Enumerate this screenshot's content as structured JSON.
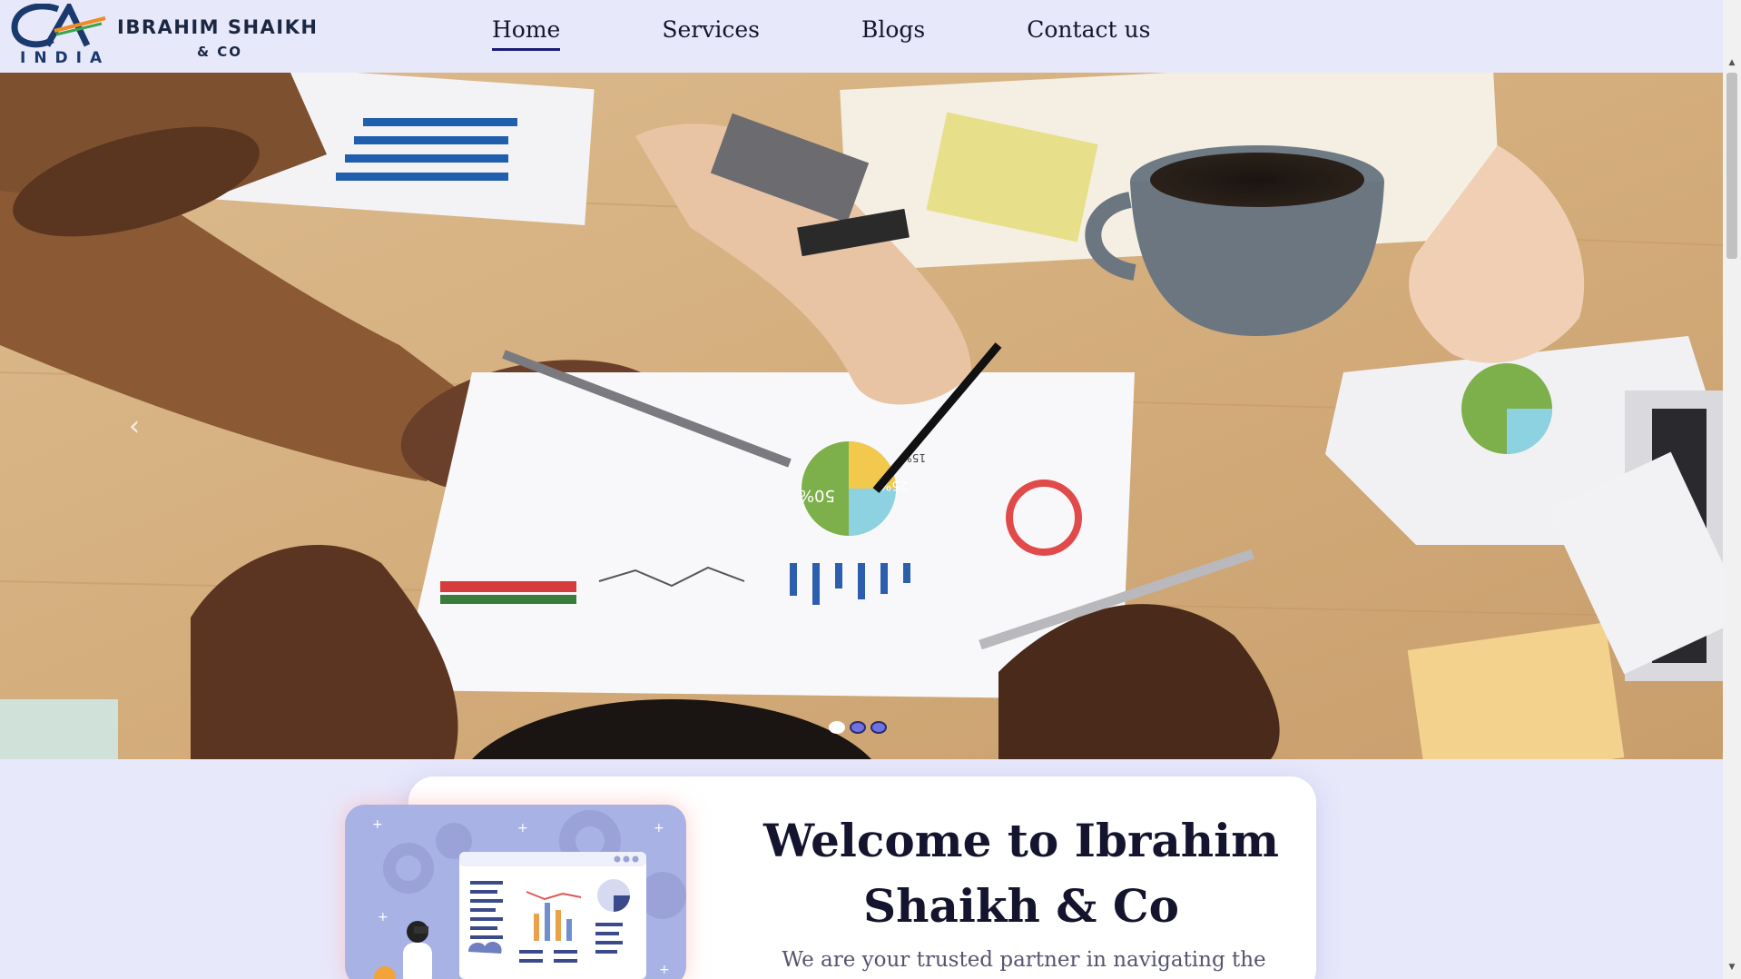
{
  "header": {
    "logo": {
      "mark": "CA",
      "country": "INDIA",
      "name": "IBRAHIM SHAIKH",
      "suffix": "& CO"
    },
    "nav": [
      {
        "label": "Home",
        "active": true
      },
      {
        "label": "Services",
        "active": false
      },
      {
        "label": "Blogs",
        "active": false
      },
      {
        "label": "Contact us",
        "active": false
      }
    ]
  },
  "hero": {
    "prev_icon": "‹",
    "next_icon": "›",
    "slide_count": 3,
    "active_slide": 1,
    "chart_labels": [
      "50%",
      "25%",
      "15%"
    ]
  },
  "welcome": {
    "title_line1": "Welcome to Ibrahim",
    "title_line2": "Shaikh & Co",
    "text": "We are your trusted partner in navigating the"
  },
  "colors": {
    "page_bg": "#e8e8fb",
    "nav_active_underline": "#1a1a7a",
    "dot_inactive": "#6f72e0",
    "card_bg": "#ffffff",
    "illustration_bg": "#a9b2e4"
  }
}
